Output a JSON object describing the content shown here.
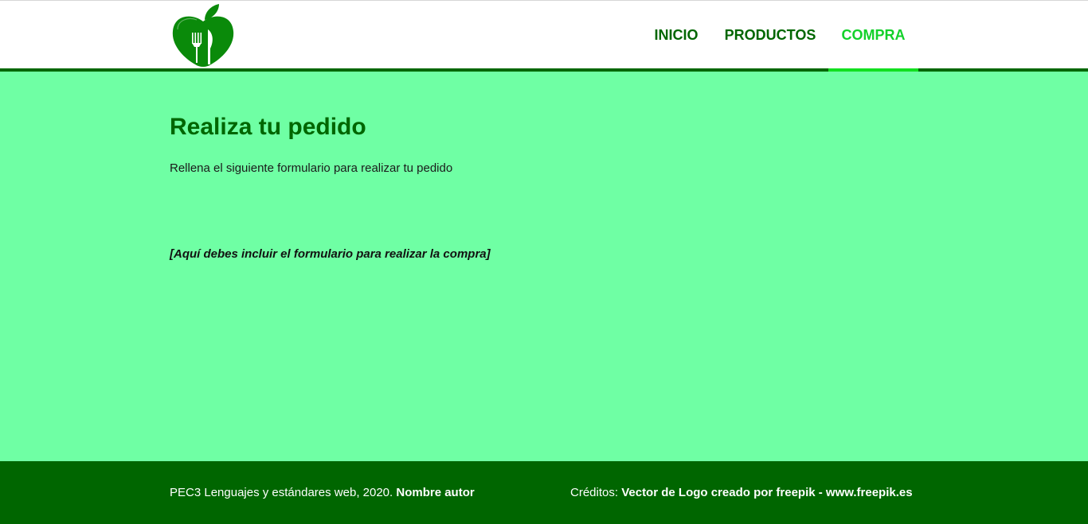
{
  "nav": {
    "items": [
      {
        "label": "INICIO",
        "active": false
      },
      {
        "label": "PRODUCTOS",
        "active": false
      },
      {
        "label": "COMPRA",
        "active": true
      }
    ]
  },
  "logo": {
    "icon": "apple-fork-knife-logo-icon"
  },
  "main": {
    "title": "Realiza tu pedido",
    "intro": "Rellena el siguiente formulario para realizar tu pedido",
    "form_placeholder": "[Aquí debes incluir el formulario para realizar la compra]"
  },
  "footer": {
    "left_text": "PEC3 Lenguajes y estándares web, 2020. ",
    "author": "Nombre autor",
    "credits_label": "Créditos: ",
    "credits_text": "Vector de Logo creado por freepik - www.freepik.es"
  },
  "colors": {
    "dark_green": "#006600",
    "light_green_bg": "#6fffa4",
    "active_nav": "#12d12a"
  }
}
